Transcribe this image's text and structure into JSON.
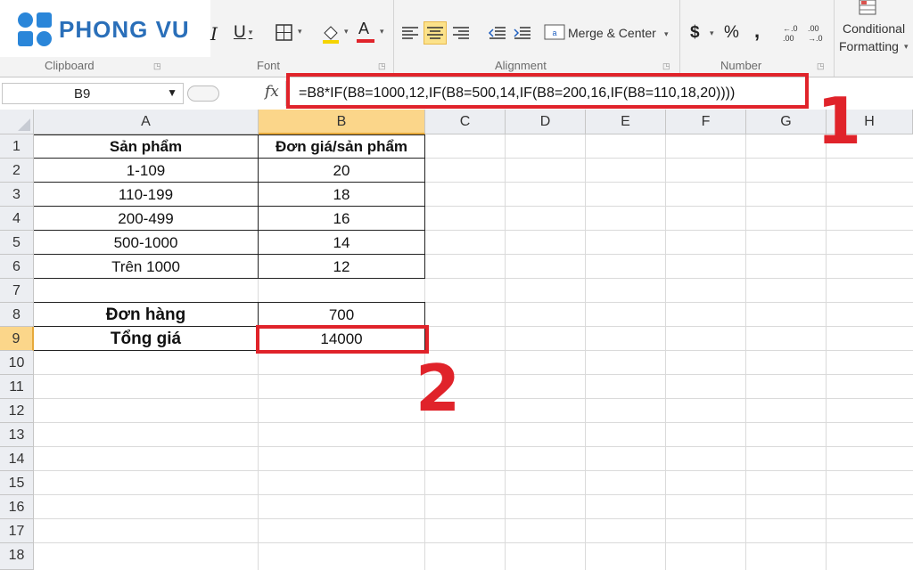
{
  "brand": {
    "name": "PHONG VU"
  },
  "ribbon": {
    "groups": {
      "clipboard": "Clipboard",
      "font": "Font",
      "alignment": "Alignment",
      "number": "Number"
    },
    "italic": "I",
    "underline": "U",
    "font_color_glyph": "A",
    "merge_center": "Merge & Center",
    "currency": "$",
    "percent": "%",
    "comma": ",",
    "conditional": "Conditional",
    "formatting": "Formatting",
    "accent_color": "#e0232a"
  },
  "formula_bar": {
    "name_box": "B9",
    "fx_label": "fx",
    "formula": "=B8*IF(B8=1000,12,IF(B8=500,14,IF(B8=200,16,IF(B8=110,18,20))))"
  },
  "annotations": {
    "one": "1",
    "two": "2"
  },
  "columns": [
    "A",
    "B",
    "C",
    "D",
    "E",
    "F",
    "G",
    "H"
  ],
  "rows": [
    "1",
    "2",
    "3",
    "4",
    "5",
    "6",
    "7",
    "8",
    "9",
    "10",
    "11",
    "12",
    "13",
    "14",
    "15",
    "16",
    "17",
    "18"
  ],
  "cells": {
    "A1": "Sản phẩm",
    "B1": "Đơn giá/sản phẩm",
    "A2": "1-109",
    "B2": "20",
    "A3": "110-199",
    "B3": "18",
    "A4": "200-499",
    "B4": "16",
    "A5": "500-1000",
    "B5": "14",
    "A6": "Trên 1000",
    "B6": "12",
    "A8": "Đơn hàng",
    "B8": "700",
    "A9": "Tổng giá",
    "B9": "14000"
  }
}
